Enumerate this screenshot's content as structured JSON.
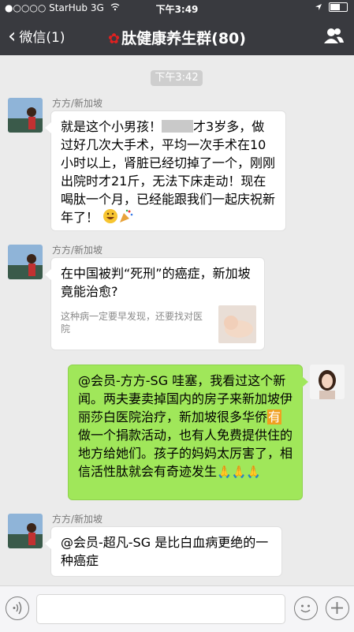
{
  "status_bar": {
    "carrier": "●○○○○ StarHub",
    "network": "3G",
    "time": "下午3:49"
  },
  "nav": {
    "back_label": "微信(1)",
    "title": "肽健康养生群(80)"
  },
  "chat": {
    "timestamp": "下午3:42",
    "messages": [
      {
        "sender": "方方/新加坡",
        "text_before_blur": "就是这个小男孩！",
        "text_after_blur": "才3岁多，做过好几次大手术，平均一次手术在10小时以上，肾脏已经切掉了一个，刚刚出院时才21斤，无法下床走动！现在喝肽一个月，已经能跟我们一起庆祝新年了！"
      },
      {
        "sender": "方方/新加坡",
        "link_title": "在中国被判“死刑”的癌症，新加坡竟能治愈?",
        "link_desc": "这种病一定要早发现，还要找对医院"
      },
      {
        "text_before_highlight": "@会员-方方-SG 哇塞，我看过这个新闻。两夫妻卖掉国内的房子来新加坡伊丽莎白医院治疗，新加坡很多华侨",
        "highlight": "有",
        "text_after_highlight": "做一个捐款活动，也有人免费提供住的地方给她们。孩子的妈妈太厉害了，相信活性肽就会有奇迹发生"
      },
      {
        "sender": "方方/新加坡",
        "text": "@会员-超凡-SG 是比白血病更绝的一种癌症"
      }
    ]
  },
  "colors": {
    "bar_bg": "#393a3f",
    "chat_bg": "#ebebeb",
    "own_bubble": "#a0e75a"
  },
  "icons": [
    "back-chevron-icon",
    "group-members-icon",
    "voice-input-icon",
    "emoji-icon",
    "add-plus-icon",
    "location-arrow-icon",
    "battery-icon",
    "pray-emoji-icon",
    "grin-emoji-icon",
    "party-popper-icon"
  ]
}
